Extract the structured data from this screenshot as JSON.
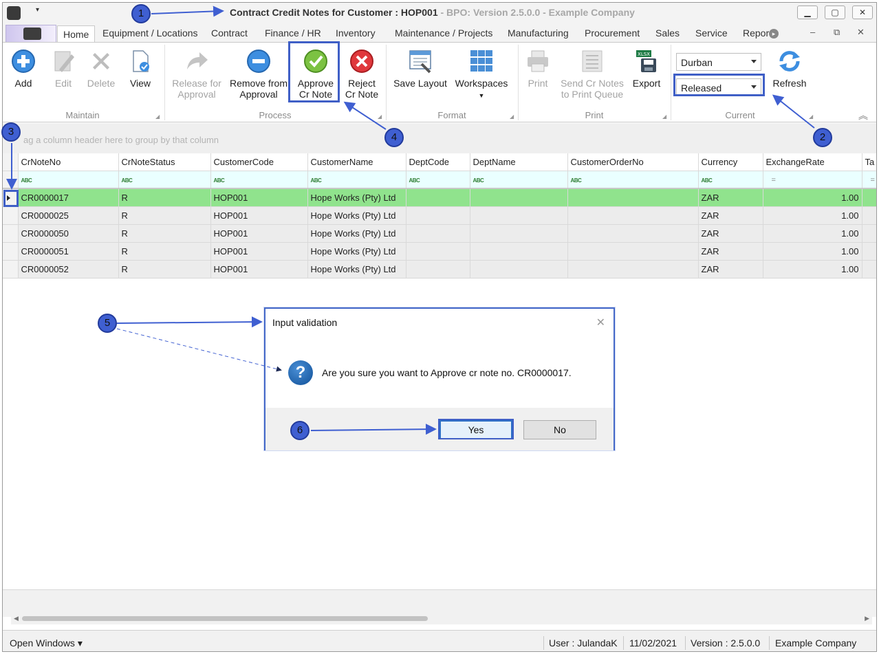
{
  "window": {
    "title": "Contract Credit Notes for Customer : HOP001",
    "subtitle": "- BPO: Version 2.5.0.0 - Example Company",
    "qat_arrow": "▾",
    "min": "▁",
    "max": "▢",
    "close": "✕"
  },
  "tabs": [
    {
      "label": "Home"
    },
    {
      "label": "Equipment / Locations"
    },
    {
      "label": "Contract"
    },
    {
      "label": "Finance / HR"
    },
    {
      "label": "Inventory"
    },
    {
      "label": "Maintenance / Projects"
    },
    {
      "label": "Manufacturing"
    },
    {
      "label": "Procurement"
    },
    {
      "label": "Sales"
    },
    {
      "label": "Service"
    },
    {
      "label": "Repor"
    }
  ],
  "mdi": {
    "min": "–",
    "restore": "⧉",
    "close": "✕"
  },
  "ribbon": {
    "maintain": {
      "label": "Maintain",
      "add": "Add",
      "edit": "Edit",
      "delete": "Delete",
      "view": "View"
    },
    "process": {
      "label": "Process",
      "release_l1": "Release for",
      "release_l2": "Approval",
      "remove_l1": "Remove from",
      "remove_l2": "Approval",
      "approve_l1": "Approve",
      "approve_l2": "Cr Note",
      "reject_l1": "Reject",
      "reject_l2": "Cr Note"
    },
    "format": {
      "label": "Format",
      "save_layout": "Save Layout",
      "workspaces": "Workspaces"
    },
    "print": {
      "label": "Print",
      "print": "Print",
      "send_l1": "Send Cr Notes",
      "send_l2": "to Print Queue",
      "export": "Export"
    },
    "current": {
      "label": "Current",
      "site": "Durban",
      "status": "Released",
      "refresh": "Refresh"
    }
  },
  "grid": {
    "group_hint": "ag a column header here to group by that column",
    "columns": [
      "CrNoteNo",
      "CrNoteStatus",
      "CustomerCode",
      "CustomerName",
      "DeptCode",
      "DeptName",
      "CustomerOrderNo",
      "Currency",
      "ExchangeRate",
      "Ta"
    ],
    "filter_abc": "ABC",
    "filter_eq": "=",
    "rows": [
      [
        "CR0000017",
        "R",
        "HOP001",
        "Hope Works (Pty) Ltd",
        "",
        "",
        "",
        "ZAR",
        "1.00"
      ],
      [
        "CR0000025",
        "R",
        "HOP001",
        "Hope Works (Pty) Ltd",
        "",
        "",
        "",
        "ZAR",
        "1.00"
      ],
      [
        "CR0000050",
        "R",
        "HOP001",
        "Hope Works (Pty) Ltd",
        "",
        "",
        "",
        "ZAR",
        "1.00"
      ],
      [
        "CR0000051",
        "R",
        "HOP001",
        "Hope Works (Pty) Ltd",
        "",
        "",
        "",
        "ZAR",
        "1.00"
      ],
      [
        "CR0000052",
        "R",
        "HOP001",
        "Hope Works (Pty) Ltd",
        "",
        "",
        "",
        "ZAR",
        "1.00"
      ]
    ]
  },
  "dialog": {
    "title": "Input validation",
    "close": "✕",
    "icon": "?",
    "message": "Are you sure you want to Approve cr note no. CR0000017.",
    "yes": "Yes",
    "no": "No"
  },
  "statusbar": {
    "open_windows": "Open Windows ▾",
    "user": "User : JulandaK",
    "date": "11/02/2021",
    "version": "Version : 2.5.0.0",
    "company": "Example Company"
  },
  "annotations": [
    "1",
    "2",
    "3",
    "4",
    "5",
    "6"
  ],
  "colors": {
    "selected_row": "#90e38d",
    "annotation": "#3f5fd1",
    "filter_row": "#eaffff"
  }
}
